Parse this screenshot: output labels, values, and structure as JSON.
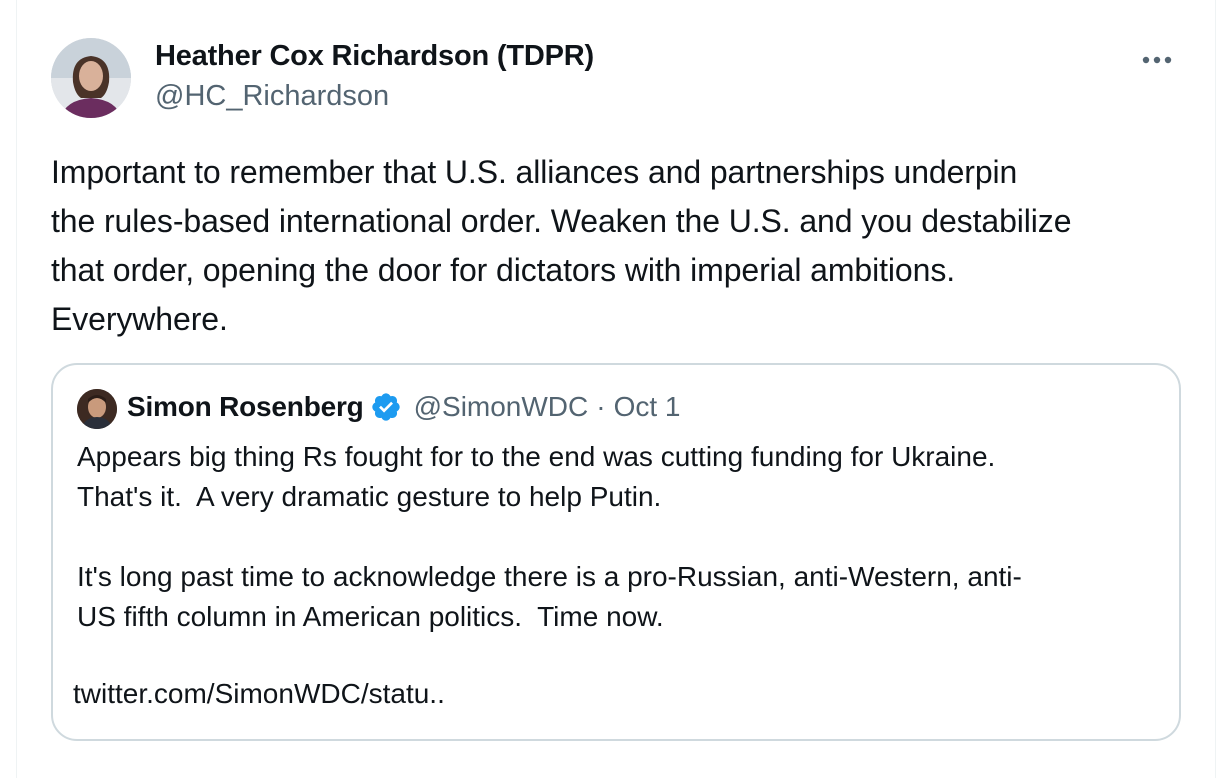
{
  "tweet": {
    "author": {
      "name": "Heather Cox Richardson (TDPR)",
      "handle": "@HC_Richardson",
      "avatar_icon": "avatar-photo"
    },
    "more_icon": "more-horizontal-icon",
    "text": "Important to remember that U.S. alliances and partnerships underpin\nthe rules-based international order. Weaken the U.S. and you destabilize\nthat order, opening the door for dictators with imperial ambitions.\nEverywhere."
  },
  "quote": {
    "author": {
      "name": "Simon Rosenberg",
      "handle": "@SimonWDC",
      "verified": true,
      "verified_icon": "verified-badge-icon"
    },
    "separator": "·",
    "date": "Oct 1",
    "text": "Appears big thing Rs fought for to the end was cutting funding for Ukraine.\nThat's it.  A very dramatic gesture to help Putin.\n\nIt's long past time to acknowledge there is a pro-Russian, anti-Western, anti-\nUS fifth column in American politics.  Time now.",
    "link": "twitter.com/SimonWDC/statu.."
  },
  "colors": {
    "text_primary": "#0f1419",
    "text_secondary": "#536471",
    "border": "#cfd9de",
    "verified_blue": "#1d9bf0"
  }
}
